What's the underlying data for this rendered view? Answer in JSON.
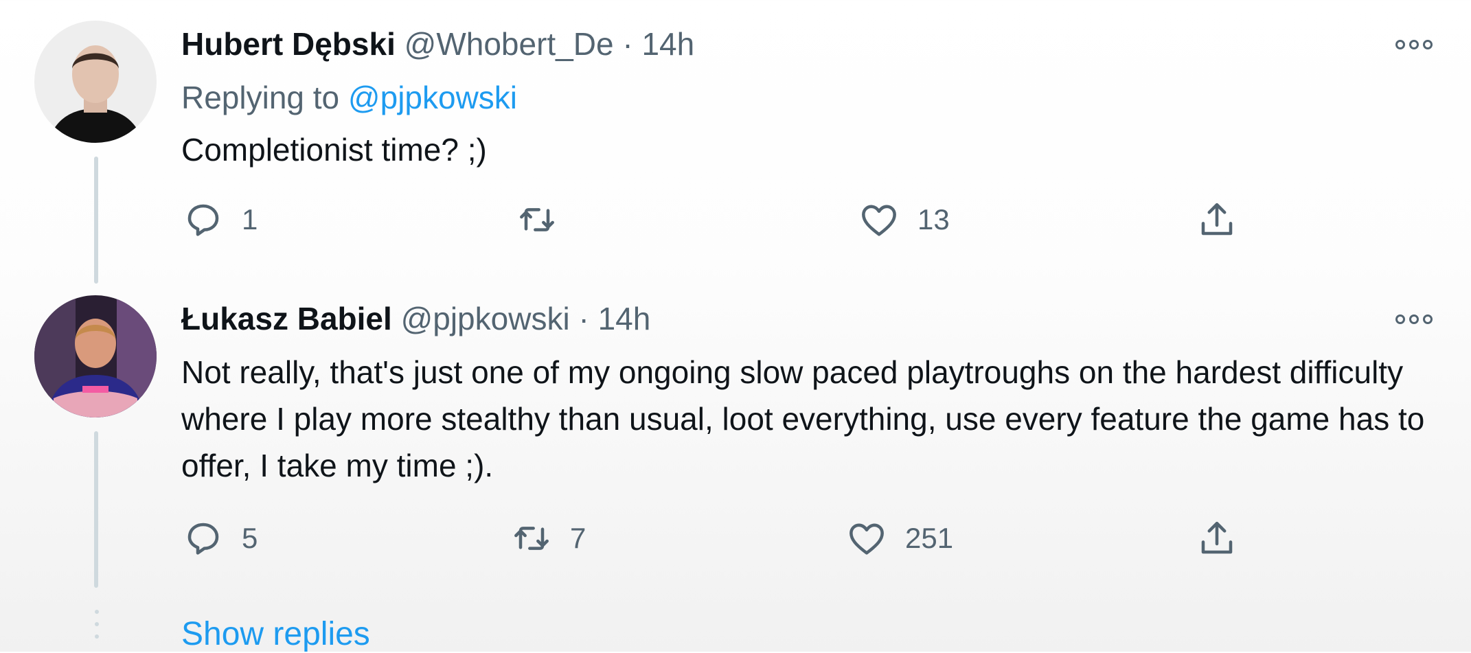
{
  "tweets": [
    {
      "name": "Hubert Dębski",
      "handle": "@Whobert_De",
      "separator": "·",
      "time": "14h",
      "replying_prefix": "Replying to",
      "replying_to": "@pjpkowski",
      "text": "Completionist time? ;)",
      "reply_count": "1",
      "retweet_count": "",
      "like_count": "13"
    },
    {
      "name": "Łukasz Babiel",
      "handle": "@pjpkowski",
      "separator": "·",
      "time": "14h",
      "text": "Not really, that's just one of my ongoing slow paced playtroughs on the hardest difficulty where I play more stealthy than usual, loot everything, use every feature the game has to offer, I take my time ;).",
      "reply_count": "5",
      "retweet_count": "7",
      "like_count": "251"
    }
  ],
  "show_replies_label": "Show replies",
  "icons": {
    "reply": "reply-icon",
    "retweet": "retweet-icon",
    "like": "heart-icon",
    "share": "share-icon",
    "more": "more-icon"
  },
  "colors": {
    "link": "#1d9bf0",
    "muted": "#536471",
    "text": "#0f1419"
  }
}
